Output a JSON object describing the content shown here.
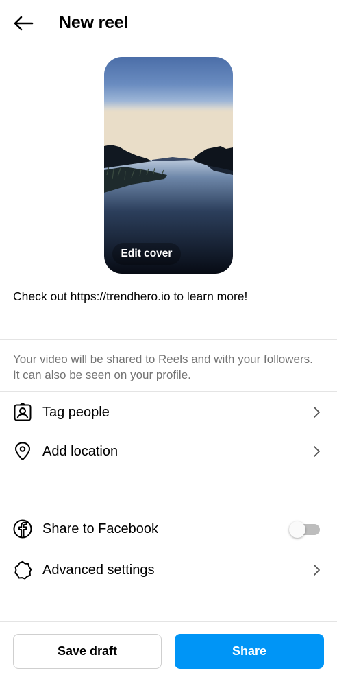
{
  "header": {
    "title": "New reel",
    "back_icon": "arrow-left-icon"
  },
  "cover": {
    "edit_label": "Edit cover"
  },
  "caption": {
    "text": "Check out https://trendhero.io to learn more!"
  },
  "info": {
    "text": "Your video will be shared to Reels and with your followers. It can also be seen on your profile."
  },
  "options": [
    {
      "label": "Tag people",
      "icon": "tag-person-icon"
    },
    {
      "label": "Add location",
      "icon": "location-pin-icon"
    },
    {
      "label": "Share to Facebook",
      "icon": "facebook-icon",
      "toggle_on": false
    },
    {
      "label": "Advanced settings",
      "icon": "gear-icon"
    }
  ],
  "footer": {
    "save_draft_label": "Save draft",
    "share_label": "Share"
  },
  "colors": {
    "accent": "#0095f6",
    "secondary_text": "#737373",
    "divider": "#e4e4e4"
  }
}
